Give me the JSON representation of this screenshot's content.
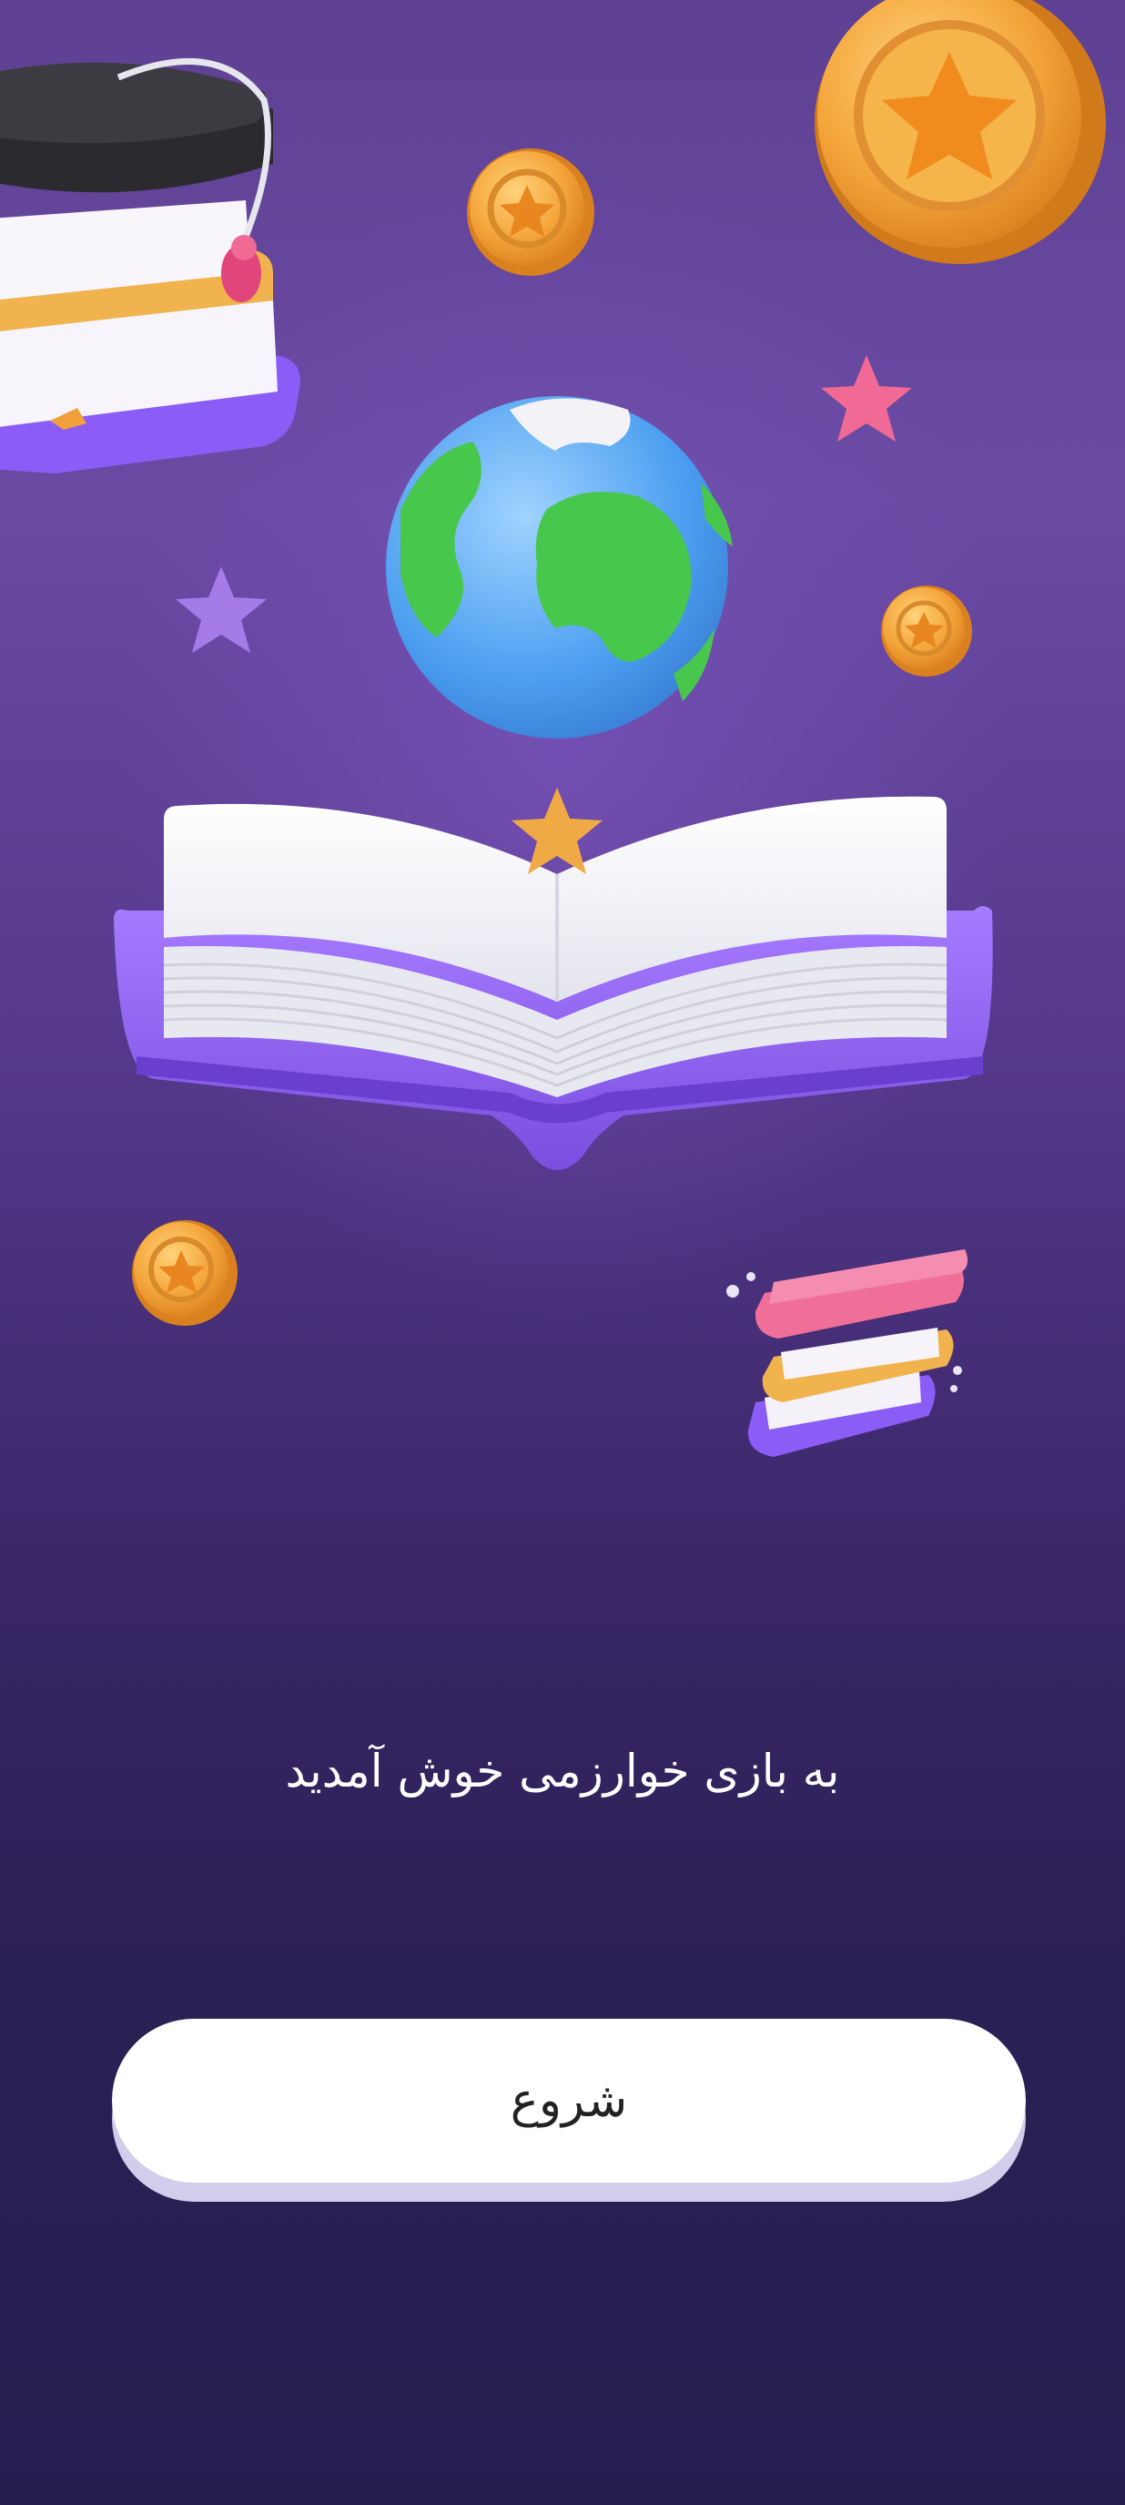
{
  "welcome_text": "به بازی خوارزمی خوش آمدید",
  "start_button_label": "شروع",
  "illustration": {
    "items": [
      "graduation-cap-icon",
      "book-stack-icon",
      "coin-icon",
      "star-icon",
      "globe-icon",
      "open-book-icon"
    ]
  },
  "colors": {
    "background_top": "#5e4193",
    "background_bottom": "#261d4f",
    "button_bg": "#ffffff",
    "button_shadow": "#d2cdea",
    "coin": "#f2a93b",
    "book_purple": "#8b5cf6"
  }
}
